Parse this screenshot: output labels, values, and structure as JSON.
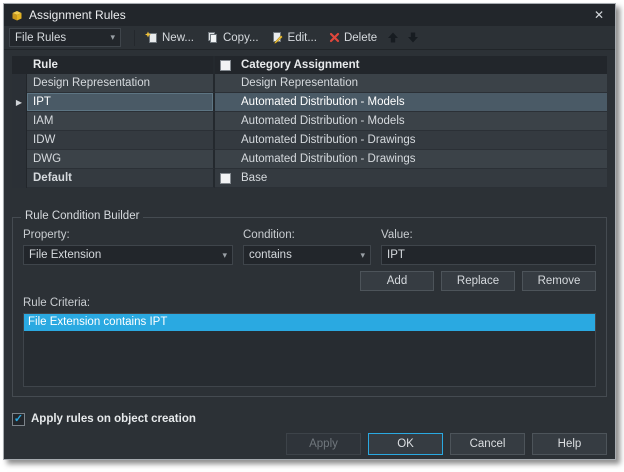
{
  "window": {
    "title": "Assignment Rules"
  },
  "icons": {
    "close": "✕",
    "chevron_down": "▾",
    "row_pointer": "▶",
    "check": "✓"
  },
  "colors": {
    "accent": "#2aa9e1",
    "delete-red": "#e0473c",
    "title-gold": "#e3b322"
  },
  "toolbar": {
    "rule_set": "File Rules",
    "new_label": "New...",
    "copy_label": "Copy...",
    "edit_label": "Edit...",
    "delete_label": "Delete"
  },
  "table": {
    "header_rule": "Rule",
    "header_category": "Category Assignment",
    "rows": [
      {
        "rule": "Design Representation",
        "category": "Design Representation",
        "selected": false,
        "bold": false,
        "checkbox": false
      },
      {
        "rule": "IPT",
        "category": "Automated Distribution - Models",
        "selected": true,
        "bold": false,
        "checkbox": false
      },
      {
        "rule": "IAM",
        "category": "Automated Distribution - Models",
        "selected": false,
        "bold": false,
        "checkbox": false
      },
      {
        "rule": "IDW",
        "category": "Automated Distribution - Drawings",
        "selected": false,
        "bold": false,
        "checkbox": false
      },
      {
        "rule": "DWG",
        "category": "Automated Distribution - Drawings",
        "selected": false,
        "bold": false,
        "checkbox": false
      },
      {
        "rule": "Default",
        "category": "Base",
        "selected": false,
        "bold": true,
        "checkbox": true
      }
    ]
  },
  "builder": {
    "title": "Rule Condition Builder",
    "property_label": "Property:",
    "condition_label": "Condition:",
    "value_label": "Value:",
    "property_value": "File Extension",
    "condition_value": "contains",
    "value_text": "IPT",
    "add_label": "Add",
    "replace_label": "Replace",
    "remove_label": "Remove",
    "criteria_label": "Rule Criteria:",
    "criteria_items": [
      "File Extension contains IPT"
    ],
    "criteria_selected_index": 0
  },
  "footer": {
    "apply_rules_label": "Apply rules on object creation",
    "apply_rules_checked": true,
    "apply_button": "Apply",
    "ok_button": "OK",
    "cancel_button": "Cancel",
    "help_button": "Help"
  }
}
